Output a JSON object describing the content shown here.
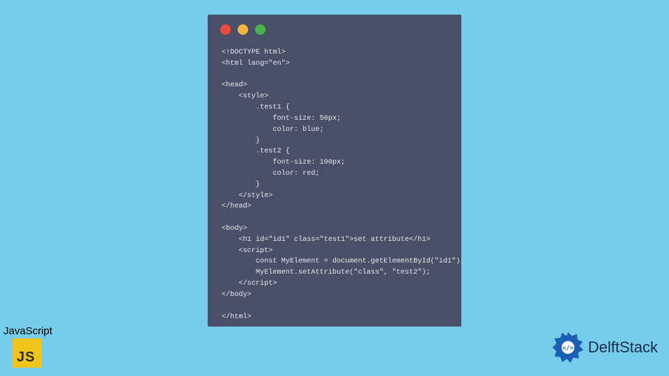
{
  "window": {
    "dots": {
      "red": "#e94b3c",
      "yellow": "#f2b63c",
      "green": "#4ab54a"
    },
    "bg": "#4a5067"
  },
  "code": {
    "lines": [
      "<!DOCTYPE html>",
      "<html lang=\"en\">",
      "",
      "<head>",
      "    <style>",
      "        .test1 {",
      "            font-size: 50px;",
      "            color: blue;",
      "        }",
      "        .test2 {",
      "            font-size: 100px;",
      "            color: red;",
      "        }",
      "    </style>",
      "</head>",
      "",
      "<body>",
      "    <h1 id=\"id1\" class=\"test1\">set attribute</h1>",
      "    <script>",
      "        const MyElement = document.getElementById(\"id1\");",
      "        MyElement.setAttribute(\"class\", \"test2\");",
      "    </script>",
      "</body>",
      "",
      "</html>"
    ]
  },
  "js_badge": {
    "label": "JavaScript",
    "logo_text": "JS"
  },
  "brand": {
    "name": "DelftStack",
    "color": "#1a5fb4"
  },
  "page_bg": "#76cdea"
}
